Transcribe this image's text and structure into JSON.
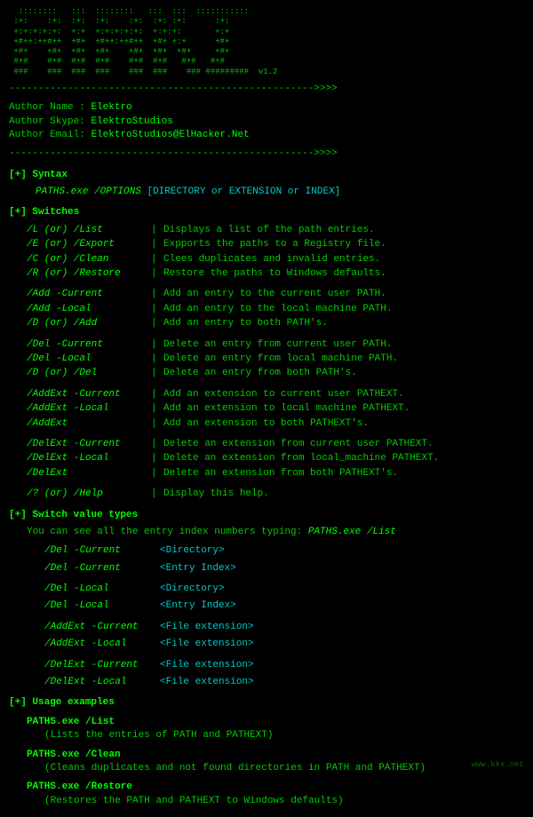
{
  "logo": {
    "line1": "  ::::::::   :::  ::::::::   :::  :::  :::::::::",
    "line2": " :+:    :+:  :+:  :+:    :+:  :+: :+:  :+:     ",
    "line3": " +:+:+:+:+:  +:+  +:+:+:+:+:  +:+:+:   +:+:+:+ ",
    "line4": " +#++:++#++  +#+  +#++:++#++  +#+ +:+  +#+      ",
    "line5": " +#+    +#+  +#+  +#+    +#+  +#+  +#+  +#+      ",
    "line6": " #+#    #+#  #+#  #+#    #+#  #+#   #+# #+#     ",
    "line7": " ###    ###  ###  ###    ###  ###    ### #########  v1.2"
  },
  "separator1": "---------------------------------------------------->>>>",
  "author": {
    "name_label": "Author Name :",
    "name_value": "Elektro",
    "skype_label": "Author Skype:",
    "skype_value": "ElektroStudios",
    "email_label": "Author Email:",
    "email_value": "ElektroStudios@ElHacker.Net"
  },
  "separator2": "---------------------------------------------------->>>>",
  "syntax": {
    "header": "[+] Syntax",
    "line": "PATHS.exe /OPTIONS [DIRECTORY or EXTENSION or INDEX]"
  },
  "switches": {
    "header": "[+] Switches",
    "groups": [
      {
        "rows": [
          {
            "cmd": "/L (or) /List  ",
            "pipe": ":",
            "desc": "Displays a list of the path entries."
          },
          {
            "cmd": "/E (or) /Export",
            "pipe": ":",
            "desc": "Expports the paths to a Registry file."
          },
          {
            "cmd": "/C (or) /Clean ",
            "pipe": ":",
            "desc": "Clees duplicates and invalid entries."
          },
          {
            "cmd": "/R (or) /Restore",
            "pipe": ":",
            "desc": "Restore the paths to Windows defaults."
          }
        ]
      },
      {
        "rows": [
          {
            "cmd": "/Add -Current  ",
            "pipe": ":",
            "desc": "Add an entry to the current user PATH."
          },
          {
            "cmd": "/Add -Local    ",
            "pipe": ":",
            "desc": "Add an entry to the local machine PATH."
          },
          {
            "cmd": "/D (or) /Add   ",
            "pipe": ":",
            "desc": "Add an entry to both PATH's."
          }
        ]
      },
      {
        "rows": [
          {
            "cmd": "/Del -Current  ",
            "pipe": ":",
            "desc": "Delete an entry from current user PATH."
          },
          {
            "cmd": "/Del -Local    ",
            "pipe": ":",
            "desc": "Delete an entry from local machine PATH."
          },
          {
            "cmd": "/D (or) /Del   ",
            "pipe": ":",
            "desc": "Delete an entry from both PATH's."
          }
        ]
      },
      {
        "rows": [
          {
            "cmd": "/AddExt -Current",
            "pipe": ":",
            "desc": "Add an extension to current user PATHEXT."
          },
          {
            "cmd": "/AddExt -Local  ",
            "pipe": ":",
            "desc": "Add an extension to local machine PATHEXT."
          },
          {
            "cmd": "/AddExt         ",
            "pipe": ":",
            "desc": "Add an extension to both PATHEXT's."
          }
        ]
      },
      {
        "rows": [
          {
            "cmd": "/DelExt -Current",
            "pipe": ":",
            "desc": "Delete an extension from current user PATHEXT."
          },
          {
            "cmd": "/DelExt -Local  ",
            "pipe": ":",
            "desc": "Delete an extension from local_machine PATHEXT."
          },
          {
            "cmd": "/DelExt         ",
            "pipe": ":",
            "desc": "Delete an extension from both PATHEXT's."
          }
        ]
      },
      {
        "rows": [
          {
            "cmd": "/? (or) /Help   ",
            "pipe": ":",
            "desc": "Display this help."
          }
        ]
      }
    ]
  },
  "switch_value_types": {
    "header": "[+] Switch value types",
    "note": "You can see all the entry index numbers typing: PATHS.exe /List",
    "rows": [
      {
        "cmd": "/Del -Current ",
        "arg": "<Directory>"
      },
      {
        "cmd": "/Del -Current ",
        "arg": "<Entry Index>"
      },
      {
        "cmd": "/Del -Local   ",
        "arg": "<Directory>"
      },
      {
        "cmd": "/Del -Local   ",
        "arg": "<Entry Index>"
      },
      {
        "cmd": "/AddExt -Current",
        "arg": "<File extension>"
      },
      {
        "cmd": "/AddExt -Local  ",
        "arg": "<File extension>"
      },
      {
        "cmd": "/DelExt -Current",
        "arg": "<File extension>"
      },
      {
        "cmd": "/DelExt -Local  ",
        "arg": "<File extension>"
      }
    ]
  },
  "usage_examples": {
    "header": "[+] Usage examples",
    "examples": [
      {
        "cmd": "PATHS.exe /List",
        "desc": "(Lists the entries of PATH and PATHEXT)"
      },
      {
        "cmd": "PATHS.exe /Clean",
        "desc": "(Cleans duplicates and not found directories in PATH and PATHEXT)"
      },
      {
        "cmd": "PATHS.exe /Restore",
        "desc": "(Restores the PATH and PATHEXT to Windows defaults)"
      }
    ]
  },
  "watermark": "www.kkx.net"
}
